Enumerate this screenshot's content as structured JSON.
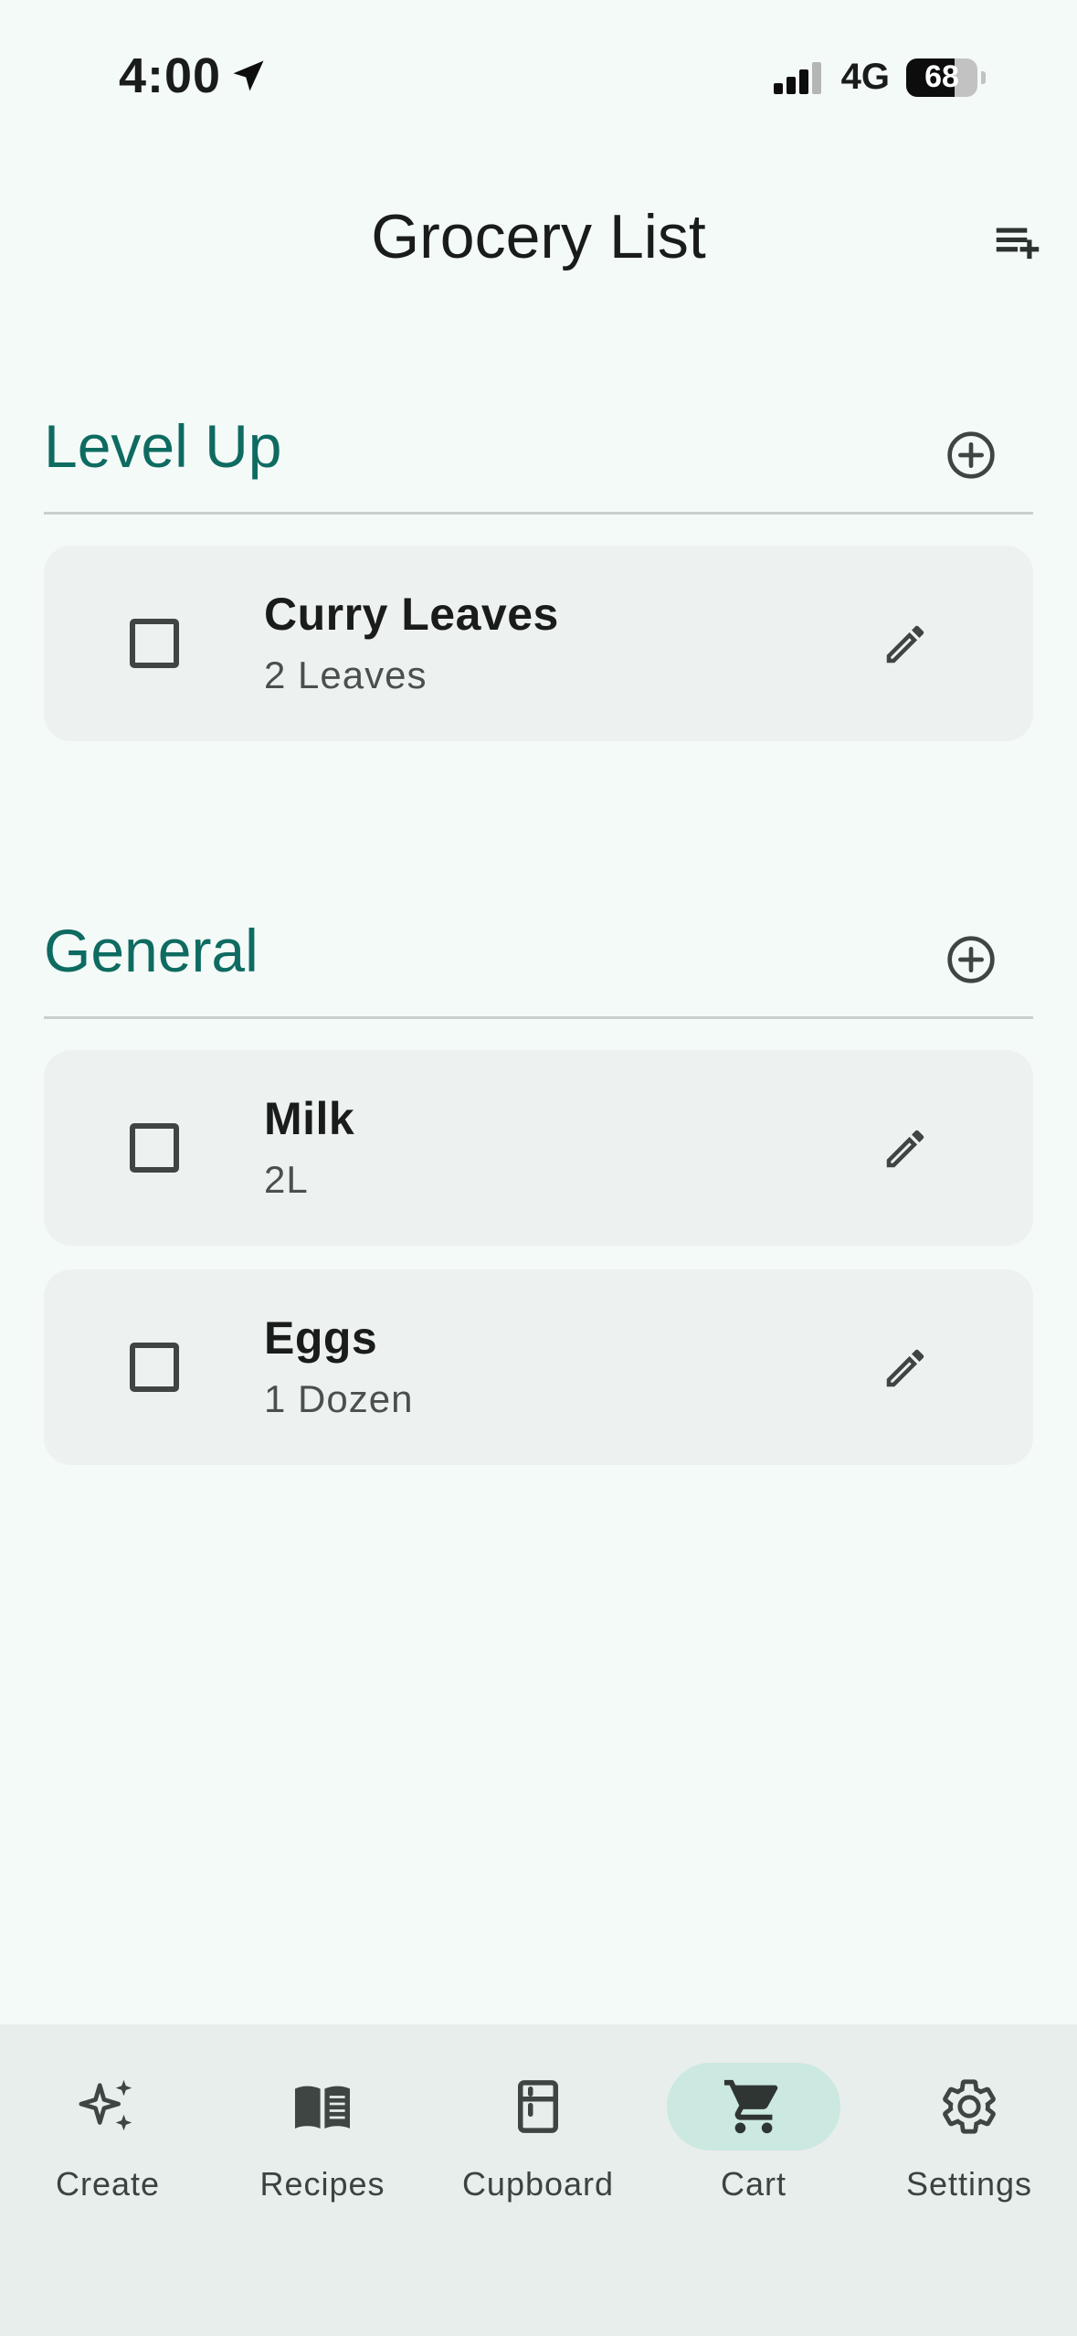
{
  "status_bar": {
    "time": "4:00",
    "network": "4G",
    "battery_level": "68",
    "battery_fraction": 0.68
  },
  "header": {
    "title": "Grocery List"
  },
  "sections": [
    {
      "title": "Level Up",
      "items": [
        {
          "name": "Curry Leaves",
          "quantity": "2 Leaves",
          "checked": false
        }
      ]
    },
    {
      "title": "General",
      "items": [
        {
          "name": "Milk",
          "quantity": "2L",
          "checked": false
        },
        {
          "name": "Eggs",
          "quantity": "1 Dozen",
          "checked": false
        }
      ]
    }
  ],
  "bottom_nav": {
    "items": [
      {
        "label": "Create",
        "icon": "sparkles-icon"
      },
      {
        "label": "Recipes",
        "icon": "book-icon"
      },
      {
        "label": "Cupboard",
        "icon": "cupboard-icon"
      },
      {
        "label": "Cart",
        "icon": "cart-icon",
        "active": true
      },
      {
        "label": "Settings",
        "icon": "gear-icon"
      }
    ]
  },
  "colors": {
    "background": "#f4faf8",
    "accent": "#0e6b61",
    "card": "#edf2f0",
    "nav_background": "#e8eeec",
    "nav_active_pill": "#cbe8e1"
  }
}
